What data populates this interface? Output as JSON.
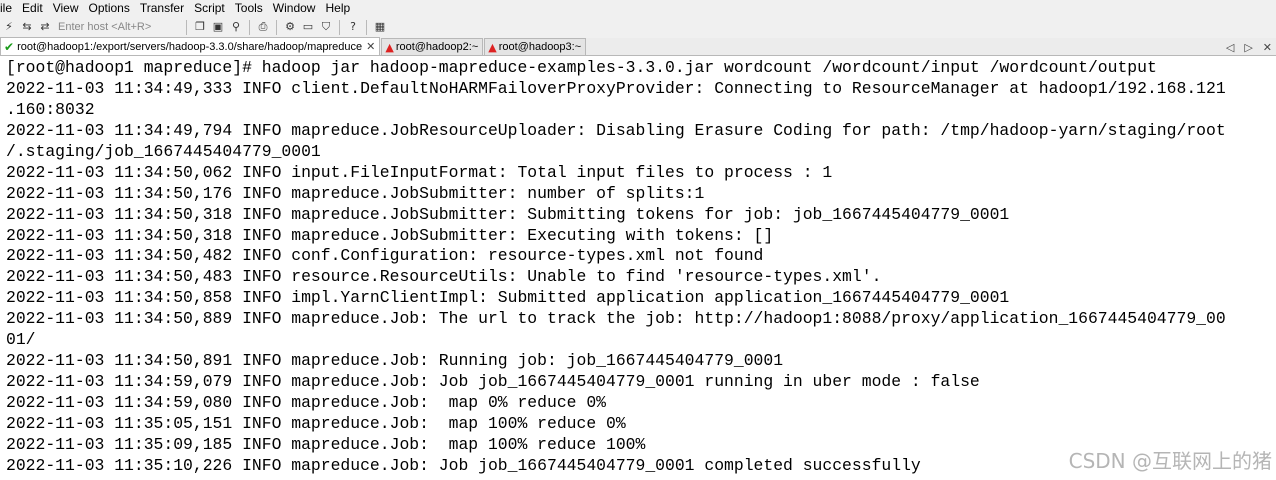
{
  "menubar": {
    "items": [
      "ile",
      "Edit",
      "View",
      "Options",
      "Transfer",
      "Script",
      "Tools",
      "Window",
      "Help"
    ]
  },
  "toolbar": {
    "host_placeholder": "Enter host <Alt+R>",
    "help_label": "?"
  },
  "tabs": [
    {
      "label": "root@hadoop1:/export/servers/hadoop-3.3.0/share/hadoop/mapreduce",
      "active": true
    },
    {
      "label": "root@hadoop2:~",
      "active": false
    },
    {
      "label": "root@hadoop3:~",
      "active": false
    }
  ],
  "terminal": {
    "lines": [
      "[root@hadoop1 mapreduce]# hadoop jar hadoop-mapreduce-examples-3.3.0.jar wordcount /wordcount/input /wordcount/output",
      "2022-11-03 11:34:49,333 INFO client.DefaultNoHARMFailoverProxyProvider: Connecting to ResourceManager at hadoop1/192.168.121",
      ".160:8032",
      "2022-11-03 11:34:49,794 INFO mapreduce.JobResourceUploader: Disabling Erasure Coding for path: /tmp/hadoop-yarn/staging/root",
      "/.staging/job_1667445404779_0001",
      "2022-11-03 11:34:50,062 INFO input.FileInputFormat: Total input files to process : 1",
      "2022-11-03 11:34:50,176 INFO mapreduce.JobSubmitter: number of splits:1",
      "2022-11-03 11:34:50,318 INFO mapreduce.JobSubmitter: Submitting tokens for job: job_1667445404779_0001",
      "2022-11-03 11:34:50,318 INFO mapreduce.JobSubmitter: Executing with tokens: []",
      "2022-11-03 11:34:50,482 INFO conf.Configuration: resource-types.xml not found",
      "2022-11-03 11:34:50,483 INFO resource.ResourceUtils: Unable to find 'resource-types.xml'.",
      "2022-11-03 11:34:50,858 INFO impl.YarnClientImpl: Submitted application application_1667445404779_0001",
      "2022-11-03 11:34:50,889 INFO mapreduce.Job: The url to track the job: http://hadoop1:8088/proxy/application_1667445404779_00",
      "01/",
      "2022-11-03 11:34:50,891 INFO mapreduce.Job: Running job: job_1667445404779_0001",
      "2022-11-03 11:34:59,079 INFO mapreduce.Job: Job job_1667445404779_0001 running in uber mode : false",
      "2022-11-03 11:34:59,080 INFO mapreduce.Job:  map 0% reduce 0%",
      "2022-11-03 11:35:05,151 INFO mapreduce.Job:  map 100% reduce 0%",
      "2022-11-03 11:35:09,185 INFO mapreduce.Job:  map 100% reduce 100%",
      "2022-11-03 11:35:10,226 INFO mapreduce.Job: Job job_1667445404779_0001 completed successfully"
    ]
  },
  "watermark": "CSDN @互联网上的猪"
}
